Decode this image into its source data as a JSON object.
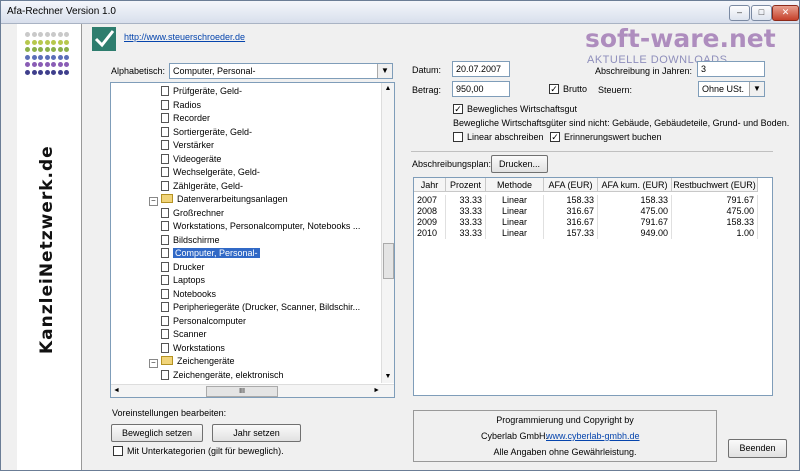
{
  "window": {
    "title": "Afa-Rechner Version 1.0",
    "controls": {
      "minimize": "–",
      "maximize": "□",
      "close": "✕"
    }
  },
  "sidebar": {
    "vertical_text": "KanzleiNetzwerk.de"
  },
  "header": {
    "url": "http://www.steuerschroeder.de"
  },
  "watermark": {
    "title": "soft-ware.net",
    "subtitle": "AKTUELLE DOWNLOADS"
  },
  "tree": {
    "label": "Alphabetisch:",
    "selected": "Computer, Personal-",
    "items": [
      {
        "text": "Prüfgeräte, Geld-",
        "type": "doc"
      },
      {
        "text": "Radios",
        "type": "doc"
      },
      {
        "text": "Recorder",
        "type": "doc"
      },
      {
        "text": "Sortiergeräte, Geld-",
        "type": "doc"
      },
      {
        "text": "Verstärker",
        "type": "doc"
      },
      {
        "text": "Videogeräte",
        "type": "doc"
      },
      {
        "text": "Wechselgeräte, Geld-",
        "type": "doc"
      },
      {
        "text": "Zählgeräte, Geld-",
        "type": "doc"
      },
      {
        "text": "Datenverarbeitungsanlagen",
        "type": "folder"
      },
      {
        "text": "Großrechner",
        "type": "doc"
      },
      {
        "text": "Workstations, Personalcomputer, Notebooks ...",
        "type": "doc"
      },
      {
        "text": "Bildschirme",
        "type": "doc"
      },
      {
        "text": "Computer, Personal-",
        "type": "doc",
        "selected": true
      },
      {
        "text": "Drucker",
        "type": "doc"
      },
      {
        "text": "Laptops",
        "type": "doc"
      },
      {
        "text": "Notebooks",
        "type": "doc"
      },
      {
        "text": "Peripheriegeräte (Drucker, Scanner, Bildschir...",
        "type": "doc"
      },
      {
        "text": "Personalcomputer",
        "type": "doc"
      },
      {
        "text": "Scanner",
        "type": "doc"
      },
      {
        "text": "Workstations",
        "type": "doc"
      },
      {
        "text": "Zeichengeräte",
        "type": "folder"
      },
      {
        "text": "Zeichengeräte, elektronisch",
        "type": "doc"
      }
    ],
    "hscroll_grip": "III"
  },
  "form": {
    "datum_label": "Datum:",
    "datum_value": "20.07.2007",
    "jahre_label": "Abschreibung in Jahren:",
    "jahre_value": "3",
    "betrag_label": "Betrag:",
    "betrag_value": "950,00",
    "brutto_label": "Brutto",
    "steuern_label": "Steuern:",
    "steuern_value": "Ohne USt.",
    "beweglich_label": "Bewegliches Wirtschaftsgut",
    "beweglich_note": "Bewegliche Wirtschaftsgüter sind nicht: Gebäude, Gebäudeteile, Grund- und Boden.",
    "linear_label": "Linear abschreiben",
    "erinnerung_label": "Erinnerungswert buchen"
  },
  "plan": {
    "label": "Abschreibungsplan:",
    "print_button": "Drucken...",
    "columns": [
      "Jahr",
      "Prozent",
      "Methode",
      "AFA (EUR)",
      "AFA kum. (EUR)",
      "Restbuchwert (EUR)"
    ],
    "rows": [
      [
        "2007",
        "33.33",
        "Linear",
        "158.33",
        "158.33",
        "791.67"
      ],
      [
        "2008",
        "33.33",
        "Linear",
        "316.67",
        "475.00",
        "475.00"
      ],
      [
        "2009",
        "33.33",
        "Linear",
        "316.67",
        "791.67",
        "158.33"
      ],
      [
        "2010",
        "33.33",
        "Linear",
        "157.33",
        "949.00",
        "1.00"
      ]
    ]
  },
  "settings": {
    "label": "Voreinstellungen bearbeiten:",
    "button_beweglich": "Beweglich setzen",
    "button_jahr": "Jahr setzen",
    "subcat_label": "Mit Unterkategorien (gilt für beweglich)."
  },
  "copyright": {
    "line1": "Programmierung und Copyright by",
    "company": "Cyberlab GmbH.",
    "link": "www.cyberlab-gmbh.de",
    "line3": "Alle Angaben ohne Gewährleistung."
  },
  "exit_button": "Beenden"
}
